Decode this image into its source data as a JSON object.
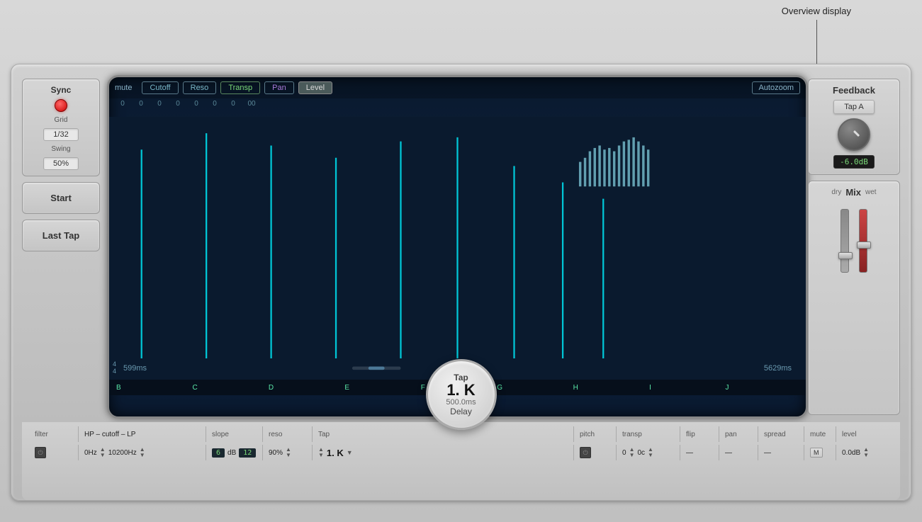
{
  "annotation": {
    "text": "Overview display",
    "line": true
  },
  "left_panel": {
    "sync": {
      "label": "Sync",
      "grid_label": "Grid",
      "grid_value": "1/32",
      "swing_label": "Swing",
      "swing_value": "50%"
    },
    "start_btn": "Start",
    "last_tap_btn": "Last Tap"
  },
  "display": {
    "mute_label": "mute",
    "tabs": [
      {
        "label": "Cutoff",
        "active": false
      },
      {
        "label": "Reso",
        "active": false
      },
      {
        "label": "Transp",
        "active": false
      },
      {
        "label": "Pan",
        "active": false
      },
      {
        "label": "Level",
        "active": true
      }
    ],
    "autozoom_label": "Autozoom",
    "time_start": "599ms",
    "time_end": "5629ms",
    "beat_labels": [
      "B",
      "C",
      "D",
      "E",
      "F",
      "G",
      "H",
      "I",
      "J"
    ],
    "time_sig": "4\n4"
  },
  "right_panel": {
    "feedback_label": "Feedback",
    "tap_a_label": "Tap A",
    "db_value": "-6.0dB",
    "mix_label": "Mix",
    "dry_label": "dry",
    "wet_label": "wet"
  },
  "bottom": {
    "filter_label": "filter",
    "filter_type": "HP – cutoff – LP",
    "hp_value": "0Hz",
    "lp_value": "10200Hz",
    "slope_label": "slope",
    "slope_value": "6",
    "slope_unit": "dB",
    "slope_value2": "12",
    "reso_label": "reso",
    "reso_value": "90%",
    "tap_label": "Tap",
    "tap_value": "1. K",
    "tap_time": "500.0ms",
    "delay_label": "Delay",
    "pitch_label": "pitch",
    "transp_label": "transp",
    "transp_value": "0",
    "transp_unit": "0c",
    "flip_label": "flip",
    "flip_value": "—",
    "pan_label": "pan",
    "pan_value": "—",
    "spread_label": "spread",
    "spread_value": "—",
    "mute_label": "mute",
    "mute_value": "M",
    "level_label": "level",
    "level_value": "0.0dB"
  }
}
